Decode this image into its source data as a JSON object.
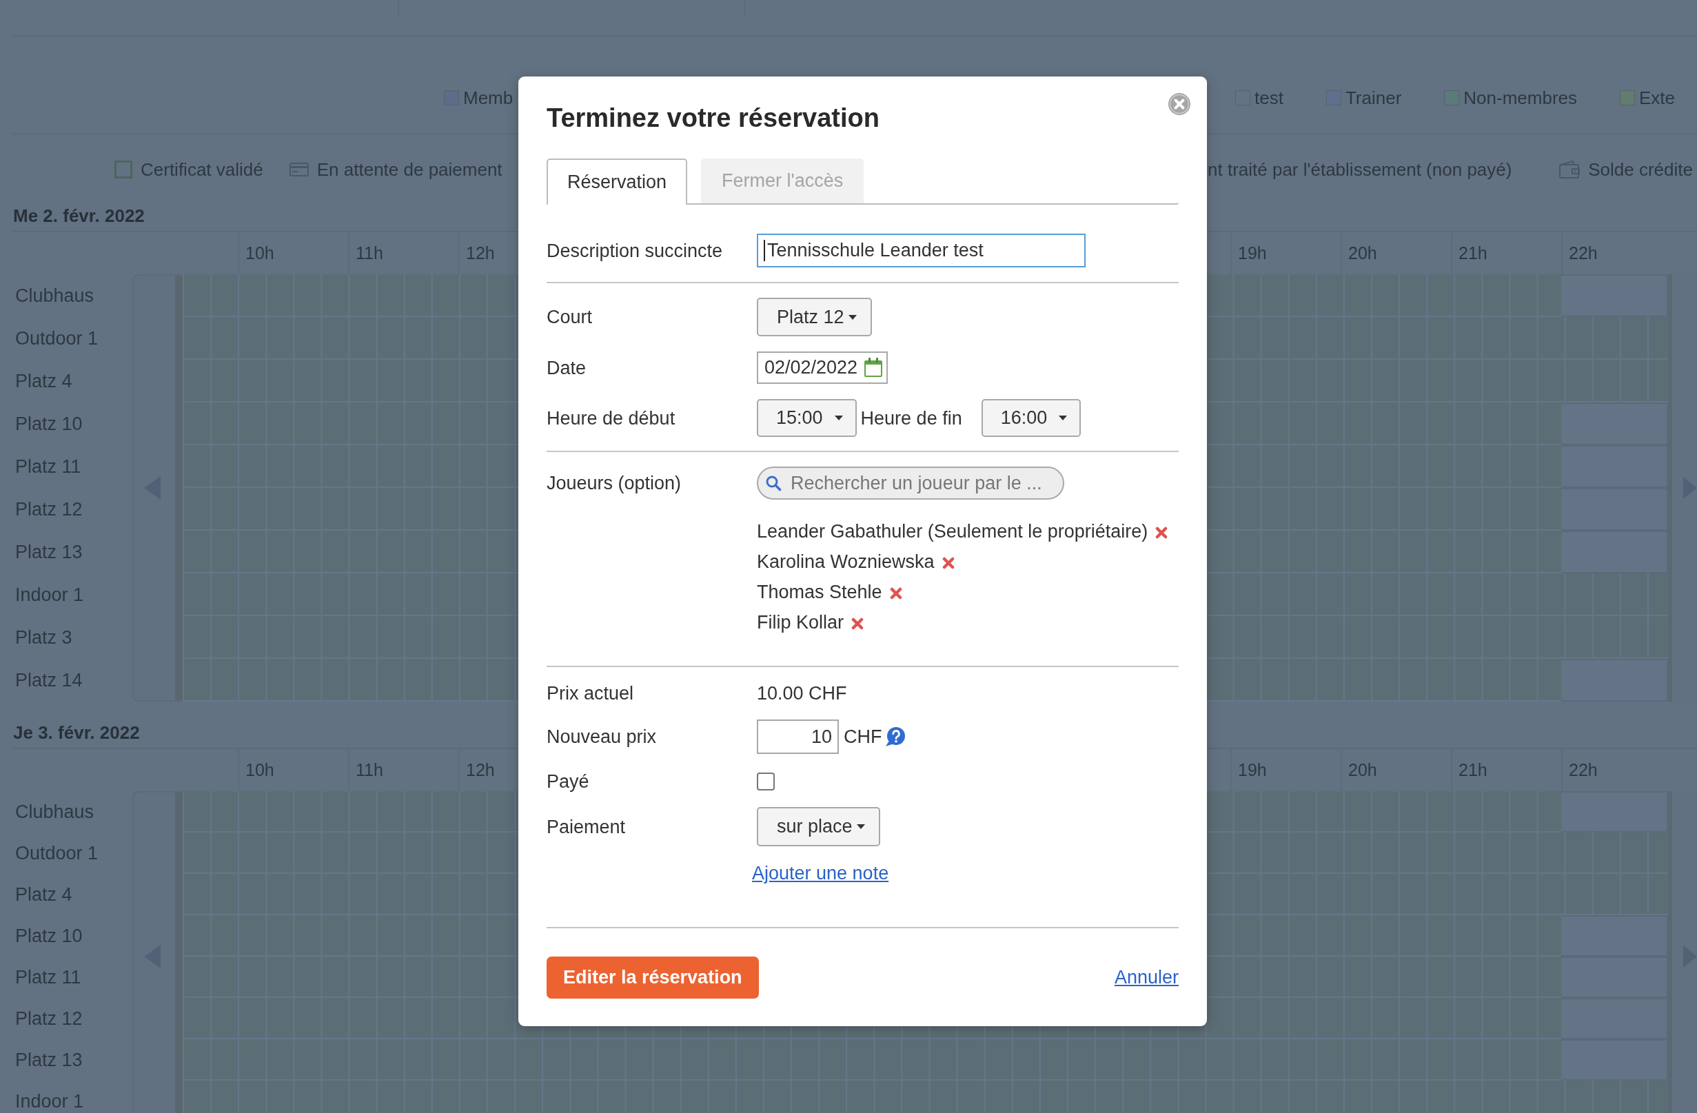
{
  "page": {
    "legend_left_of_dialog": [
      {
        "label": "Memb",
        "color": "#5e6c89"
      }
    ],
    "legend_right_of_dialog": [
      {
        "label": "test",
        "color": "#647384"
      },
      {
        "label": "Trainer",
        "color": "#616f8e"
      },
      {
        "label": "Non-membres",
        "color": "#5b7a7a"
      },
      {
        "label": "Exte",
        "color": "#627c6e"
      }
    ],
    "status_left_of_dialog": [
      {
        "kind": "certificate",
        "label": "Certificat validé"
      },
      {
        "kind": "card",
        "label": "En attente de paiement"
      }
    ],
    "status_right_of_dialog": [
      {
        "kind": "text",
        "label": "nt traité par l'établissement (non payé)"
      },
      {
        "kind": "wallet",
        "label": "Solde crédite"
      }
    ],
    "days": [
      {
        "date": "Me 2. févr. 2022",
        "hours_left_of_dialog": [
          "10h",
          "11h",
          "12h"
        ],
        "hours_right_of_dialog": [
          "19h",
          "20h",
          "21h",
          "22h"
        ],
        "courts": [
          {
            "name": "Clubhaus",
            "slots_after_22h": false
          },
          {
            "name": "Outdoor 1",
            "slots_after_22h": true
          },
          {
            "name": "Platz 4",
            "slots_after_22h": true
          },
          {
            "name": "Platz 10",
            "slots_after_22h": false
          },
          {
            "name": "Platz 11",
            "slots_after_22h": false
          },
          {
            "name": "Platz 12",
            "slots_after_22h": false
          },
          {
            "name": "Platz 13",
            "slots_after_22h": false
          },
          {
            "name": "Indoor 1",
            "slots_after_22h": true
          },
          {
            "name": "Platz 3",
            "slots_after_22h": true
          },
          {
            "name": "Platz 14",
            "slots_after_22h": false
          }
        ]
      },
      {
        "date": "Je 3. févr. 2022",
        "hours_left_of_dialog": [
          "10h",
          "11h",
          "12h"
        ],
        "hours_right_of_dialog": [
          "19h",
          "20h",
          "21h",
          "22h"
        ],
        "courts": [
          {
            "name": "Clubhaus",
            "slots_after_22h": false
          },
          {
            "name": "Outdoor 1",
            "slots_after_22h": true
          },
          {
            "name": "Platz 4",
            "slots_after_22h": true
          },
          {
            "name": "Platz 10",
            "slots_after_22h": false
          },
          {
            "name": "Platz 11",
            "slots_after_22h": false
          },
          {
            "name": "Platz 12",
            "slots_after_22h": false
          },
          {
            "name": "Platz 13",
            "slots_after_22h": false
          },
          {
            "name": "Indoor 1",
            "slots_after_22h": true
          }
        ]
      }
    ]
  },
  "dialog": {
    "title": "Terminez votre réservation",
    "tabs": [
      {
        "label": "Réservation",
        "selected": true
      },
      {
        "label": "Fermer l'accès",
        "selected": false
      }
    ],
    "description": {
      "label": "Description succincte",
      "value": "Tennisschule Leander test",
      "focused": true
    },
    "court": {
      "label": "Court",
      "value": "Platz 12"
    },
    "date": {
      "label": "Date",
      "value": "02/02/2022"
    },
    "start_time": {
      "label": "Heure de début",
      "value": "15:00"
    },
    "end_time": {
      "label": "Heure de fin",
      "value": "16:00"
    },
    "players": {
      "label": "Joueurs (option)",
      "placeholder": "Rechercher un joueur par le ...",
      "list": [
        "Leander Gabathuler (Seulement le propriétaire)",
        "Karolina Wozniewska",
        "Thomas Stehle",
        "Filip Kollar"
      ]
    },
    "current_price": {
      "label": "Prix actuel",
      "value": "10.00 CHF"
    },
    "new_price": {
      "label": "Nouveau prix",
      "value": "10",
      "unit": "CHF"
    },
    "paid": {
      "label": "Payé",
      "checked": false
    },
    "payment": {
      "label": "Paiement",
      "value": "sur place"
    },
    "add_note_link": "Ajouter une note",
    "submit_button": "Editer la réservation",
    "cancel_link": "Annuler"
  }
}
